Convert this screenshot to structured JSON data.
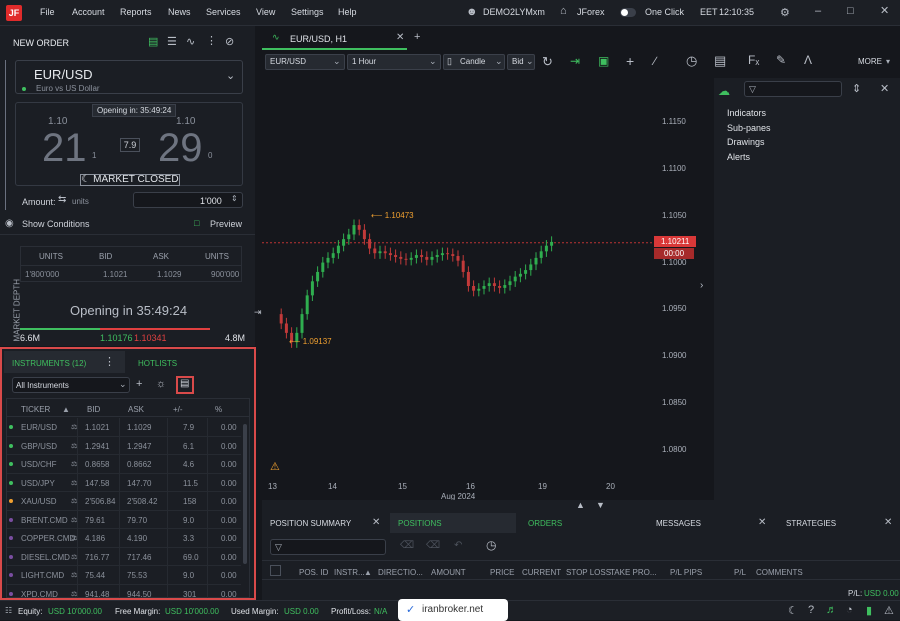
{
  "menubar": {
    "items": [
      "File",
      "Account",
      "Reports",
      "News",
      "Services",
      "View",
      "Settings",
      "Help"
    ],
    "account": "DEMO2LYMxm",
    "platform": "JForex",
    "one_click": "One Click",
    "timezone": "EET",
    "time": "12:10:35",
    "logo": "JF"
  },
  "order": {
    "title": "NEW ORDER",
    "instrument": "EUR/USD",
    "instrument_desc": "Euro vs US Dollar",
    "opening": "Opening in: 35:49:24",
    "sell_prefix": "1.10",
    "sell_big": "21",
    "sell_small": "1",
    "buy_prefix": "1.10",
    "buy_big": "29",
    "buy_small": "0",
    "spread": "7.9",
    "market_closed": "MARKET CLOSED",
    "amount_label": "Amount:",
    "units_label": "units",
    "amount_value": "1'000",
    "show_conditions": "Show Conditions",
    "preview": "Preview"
  },
  "depth": {
    "side_label": "MARKET DEPTH",
    "headers": [
      "UNITS",
      "BID",
      "ASK",
      "UNITS"
    ],
    "row": [
      "1'800'000",
      "1.1021",
      "1.1029",
      "900'000"
    ],
    "opening_text": "Opening in 35:49:24",
    "left_vol": "6.6M",
    "bid": "1.10176",
    "ask": "1.10341",
    "right_vol": "4.8M"
  },
  "instruments": {
    "tab_label": "INSTRUMENTS (12)",
    "hotlists_label": "HOTLISTS",
    "filter": "All Instruments",
    "headers": [
      "TICKER",
      "BID",
      "ASK",
      "+/-",
      "%"
    ],
    "rows": [
      {
        "ticker": "EUR/USD",
        "bid": "1.1021",
        "ask": "1.1029",
        "chg": "7.9",
        "pct": "0.00",
        "dot": "#3fbf5f"
      },
      {
        "ticker": "GBP/USD",
        "bid": "1.2941",
        "ask": "1.2947",
        "chg": "6.1",
        "pct": "0.00",
        "dot": "#3fbf5f"
      },
      {
        "ticker": "USD/CHF",
        "bid": "0.8658",
        "ask": "0.8662",
        "chg": "4.6",
        "pct": "0.00",
        "dot": "#3fbf5f"
      },
      {
        "ticker": "USD/JPY",
        "bid": "147.58",
        "ask": "147.70",
        "chg": "11.5",
        "pct": "0.00",
        "dot": "#3fbf5f"
      },
      {
        "ticker": "XAU/USD",
        "bid": "2'506.84",
        "ask": "2'508.42",
        "chg": "158",
        "pct": "0.00",
        "dot": "#f0a030"
      },
      {
        "ticker": "BRENT.CMD",
        "bid": "79.61",
        "ask": "79.70",
        "chg": "9.0",
        "pct": "0.00",
        "dot": "#7a4ea0"
      },
      {
        "ticker": "COPPER.CMD",
        "bid": "4.186",
        "ask": "4.190",
        "chg": "3.3",
        "pct": "0.00",
        "dot": "#7a4ea0"
      },
      {
        "ticker": "DIESEL.CMD",
        "bid": "716.77",
        "ask": "717.46",
        "chg": "69.0",
        "pct": "0.00",
        "dot": "#7a4ea0"
      },
      {
        "ticker": "LIGHT.CMD",
        "bid": "75.44",
        "ask": "75.53",
        "chg": "9.0",
        "pct": "0.00",
        "dot": "#7a4ea0"
      },
      {
        "ticker": "XPD.CMD",
        "bid": "941.48",
        "ask": "944.50",
        "chg": "301",
        "pct": "0.00",
        "dot": "#7a4ea0"
      }
    ]
  },
  "chart": {
    "tab": "EUR/USD, H1",
    "instrument": "EUR/USD",
    "period": "1 Hour",
    "type": "Candle",
    "side": "Bid",
    "more": "MORE",
    "high_label": "1.10473",
    "low_label": "1.09137",
    "price_label": "1.10211",
    "countdown": "00:00",
    "y_ticks": [
      "1.1150",
      "1.1100",
      "1.1050",
      "1.1000",
      "1.0950",
      "1.0900",
      "1.0850",
      "1.0800"
    ],
    "x_ticks": [
      "13",
      "14",
      "15",
      "16",
      "19",
      "20"
    ],
    "x_month": "Aug 2024"
  },
  "side": {
    "items": [
      "Indicators",
      "Sub-panes",
      "Drawings",
      "Alerts"
    ]
  },
  "bottom": {
    "tabs": [
      "POSITION SUMMARY",
      "POSITIONS",
      "ORDERS",
      "MESSAGES",
      "STRATEGIES"
    ],
    "headers": [
      "POS. ID",
      "INSTR...",
      "DIRECTIO...",
      "AMOUNT",
      "PRICE",
      "CURRENT",
      "STOP LOSS",
      "TAKE PRO...",
      "P/L PIPS",
      "P/L",
      "COMMENTS"
    ],
    "pl": "P/L:",
    "pl_value": "USD 0.00"
  },
  "status": {
    "equity_label": "Equity:",
    "equity": "USD 10'000.00",
    "free_label": "Free Margin:",
    "free": "USD 10'000.00",
    "used_label": "Used Margin:",
    "used": "USD 0.00",
    "pl_label": "Profit/Loss:",
    "pl": "N/A",
    "watermark": "iranbroker.net"
  }
}
